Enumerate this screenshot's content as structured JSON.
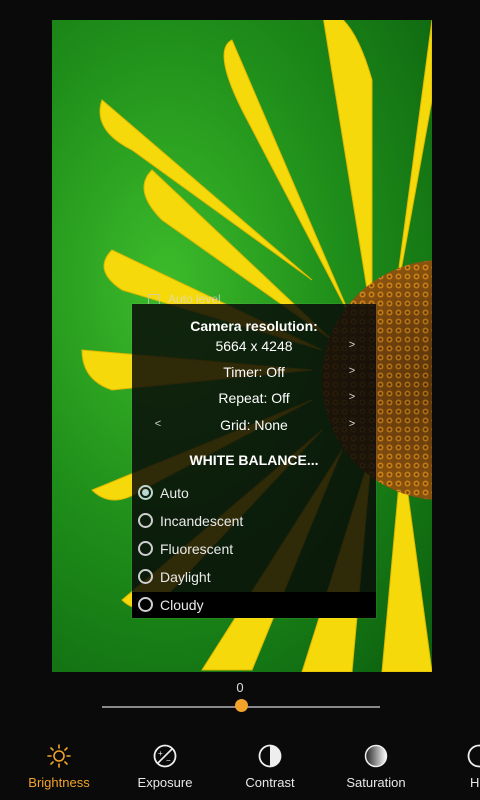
{
  "overlay": {
    "peek_text": "Auto level",
    "resolution_title": "Camera resolution:",
    "resolution_value": "5664 x 4248",
    "timer": "Timer: Off",
    "repeat": "Repeat: Off",
    "grid": "Grid: None",
    "arrow_right": ">",
    "arrow_left": "<",
    "white_balance_title": "WHITE BALANCE...",
    "white_balance_options": [
      "Auto",
      "Incandescent",
      "Fluorescent",
      "Daylight",
      "Cloudy"
    ],
    "selected": "Auto"
  },
  "slider": {
    "value": "0",
    "position_fraction": 0.5
  },
  "toolbar": {
    "items": [
      {
        "label": "Brightness",
        "icon": "sun-icon",
        "active": true
      },
      {
        "label": "Exposure",
        "icon": "exposure-icon",
        "active": false
      },
      {
        "label": "Contrast",
        "icon": "contrast-icon",
        "active": false
      },
      {
        "label": "Saturation",
        "icon": "saturation-icon",
        "active": false
      },
      {
        "label": "H",
        "icon": "hue-icon",
        "active": false
      }
    ]
  },
  "colors": {
    "accent": "#f2a32a",
    "background": "#0a0a0a"
  }
}
